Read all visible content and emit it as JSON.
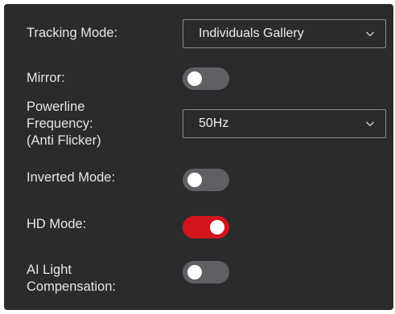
{
  "colors": {
    "panel_bg": "#2a2b2d",
    "toggle_off": "#5f6063",
    "toggle_on": "#d2151c",
    "text": "#e6e6e6"
  },
  "settings": {
    "tracking_mode": {
      "label": "Tracking Mode:",
      "value": "Individuals Gallery",
      "icon": "chevron-down-icon"
    },
    "mirror": {
      "label": "Mirror:",
      "on": false
    },
    "powerline_frequency": {
      "label": "Powerline\nFrequency:\n(Anti Flicker)",
      "value": "50Hz",
      "icon": "chevron-down-icon"
    },
    "inverted_mode": {
      "label": "Inverted Mode:",
      "on": false
    },
    "hd_mode": {
      "label": "HD Mode:",
      "on": true
    },
    "ai_light_compensation": {
      "label": "AI Light\nCompensation:",
      "on": false
    }
  }
}
